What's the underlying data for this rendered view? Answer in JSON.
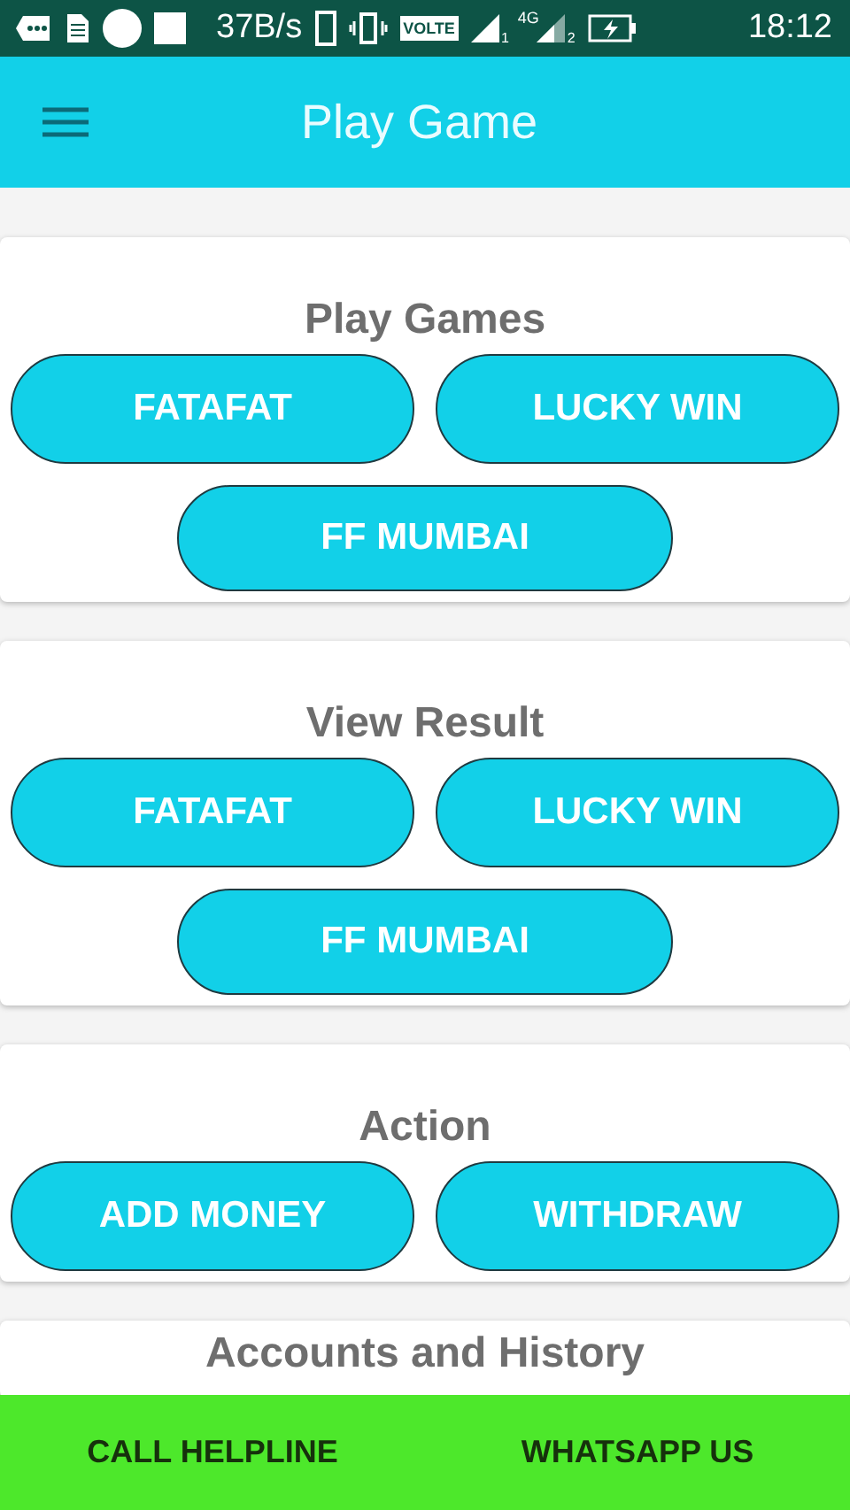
{
  "status_bar": {
    "speed": "37B/s",
    "volte": "VOLTE",
    "network": "4G",
    "sim_1": "1",
    "sim_2": "2",
    "time": "18:12"
  },
  "app_bar": {
    "title": "Play Game"
  },
  "sections": [
    {
      "title": "Play Games",
      "buttons": [
        "FATAFAT",
        "LUCKY WIN",
        "FF MUMBAI"
      ]
    },
    {
      "title": "View Result",
      "buttons": [
        "FATAFAT",
        "LUCKY WIN",
        "FF MUMBAI"
      ]
    },
    {
      "title": "Action",
      "buttons": [
        "ADD MONEY",
        "WITHDRAW"
      ]
    },
    {
      "title": "Accounts and History"
    }
  ],
  "bottom_bar": {
    "buttons": [
      "CALL HELPLINE",
      "WHATSAPP US"
    ]
  }
}
